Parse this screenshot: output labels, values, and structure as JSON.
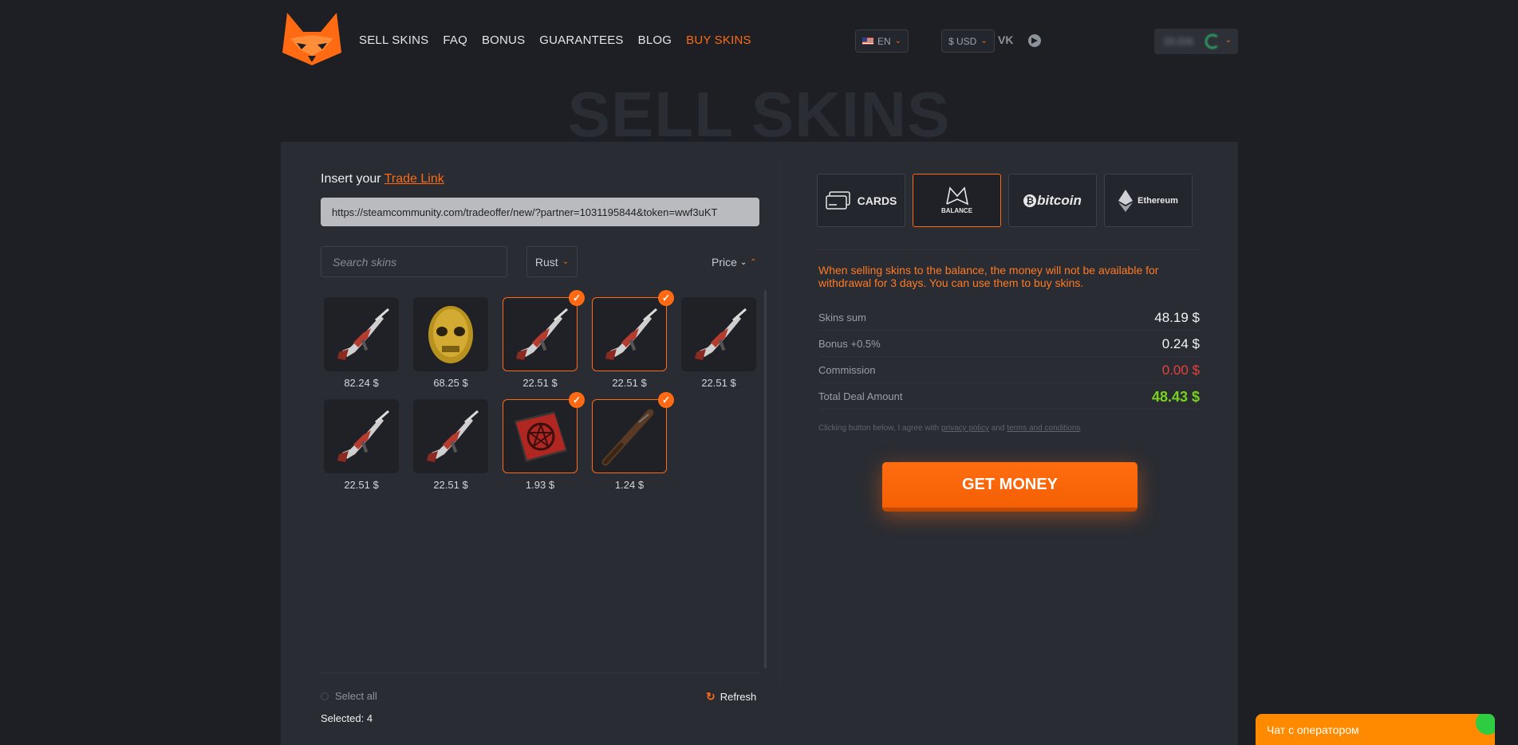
{
  "nav": [
    "SELL SKINS",
    "FAQ",
    "BONUS",
    "GUARANTEES",
    "BLOG",
    "BUY SKINS"
  ],
  "lang": "EN",
  "currency": "$ USD",
  "social": {
    "vk": "VK"
  },
  "user": {
    "balance": "23.316"
  },
  "page_title": "SELL SKINS",
  "trade": {
    "label_prefix": "Insert your",
    "label_link": "Trade Link",
    "value": "https://steamcommunity.com/tradeoffer/new/?partner=1031195844&token=wwf3uKT"
  },
  "filters": {
    "search_placeholder": "Search skins",
    "game": "Rust",
    "sort": "Price"
  },
  "items": [
    {
      "type": "rifle",
      "price": "82.24 $",
      "selected": false
    },
    {
      "type": "mask",
      "price": "68.25 $",
      "selected": false
    },
    {
      "type": "rifle",
      "price": "22.51 $",
      "selected": true
    },
    {
      "type": "rifle",
      "price": "22.51 $",
      "selected": true
    },
    {
      "type": "rifle",
      "price": "22.51 $",
      "selected": false
    },
    {
      "type": "rifle",
      "price": "22.51 $",
      "selected": false
    },
    {
      "type": "rifle",
      "price": "22.51 $",
      "selected": false
    },
    {
      "type": "box",
      "price": "1.93 $",
      "selected": true
    },
    {
      "type": "bat",
      "price": "1.24 $",
      "selected": true
    }
  ],
  "select_all": "Select all",
  "refresh": "Refresh",
  "selected": "Selected: 4",
  "methods": {
    "cards": "CARDS",
    "balance": "BALANCE",
    "bitcoin": "bitcoin",
    "ethereum": "Ethereum"
  },
  "warning": "When selling skins to the balance, the money will not be available for withdrawal for 3 days. You can use them to buy skins.",
  "summary": [
    {
      "label": "Skins sum",
      "value": "48.19 $",
      "style": ""
    },
    {
      "label": "Bonus +0.5%",
      "value": "0.24 $",
      "style": ""
    },
    {
      "label": "Commission",
      "value": "0.00 $",
      "style": "red"
    },
    {
      "label": "Total Deal Amount",
      "value": "48.43 $",
      "style": "green"
    }
  ],
  "terms": {
    "prefix": "Clicking button below, I agree with",
    "privacy": "privacy policy",
    "and": "and",
    "conditions": "terms and conditions"
  },
  "cta": "GET MONEY",
  "chat": "Чат с оператором",
  "colors": {
    "accent": "#ff6a13",
    "green": "#79d21f",
    "red": "#e8423d"
  }
}
